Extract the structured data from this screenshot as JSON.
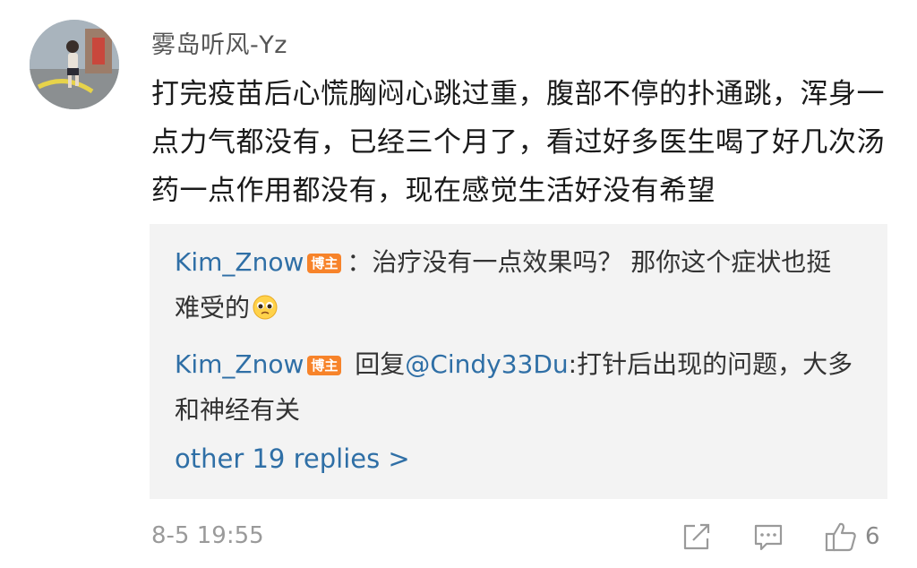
{
  "comment": {
    "username": "雾岛听风-Yz",
    "text": "打完疫苗后心慌胸闷心跳过重，腹部不停的扑通跳，浑身一点力气都没有，已经三个月了，看过好多医生喝了好几次汤药一点作用都没有，现在感觉生活好没有希望",
    "timestamp": "8-5 19:55",
    "like_count": "6"
  },
  "replies": [
    {
      "author": "Kim_Znow",
      "badge": "博主",
      "separator": "：",
      "text": "治疗没有一点效果吗？ 那你这个症状也挺难受的",
      "emoji": "pleading-face-emoji"
    },
    {
      "author": "Kim_Znow",
      "badge": "博主",
      "prefix": " 回复",
      "mention": "@Cindy33Du",
      "text": ":打针后出现的问题，大多和神经有关"
    }
  ],
  "more_replies": "other 19 replies >",
  "icons": {
    "share": "share-icon",
    "comment": "comment-icon",
    "like": "thumbs-up-icon"
  },
  "colors": {
    "link": "#2f6fa6",
    "badge": "#f7832a",
    "reply_bg": "#f3f3f3",
    "muted": "#9a9a9a"
  }
}
